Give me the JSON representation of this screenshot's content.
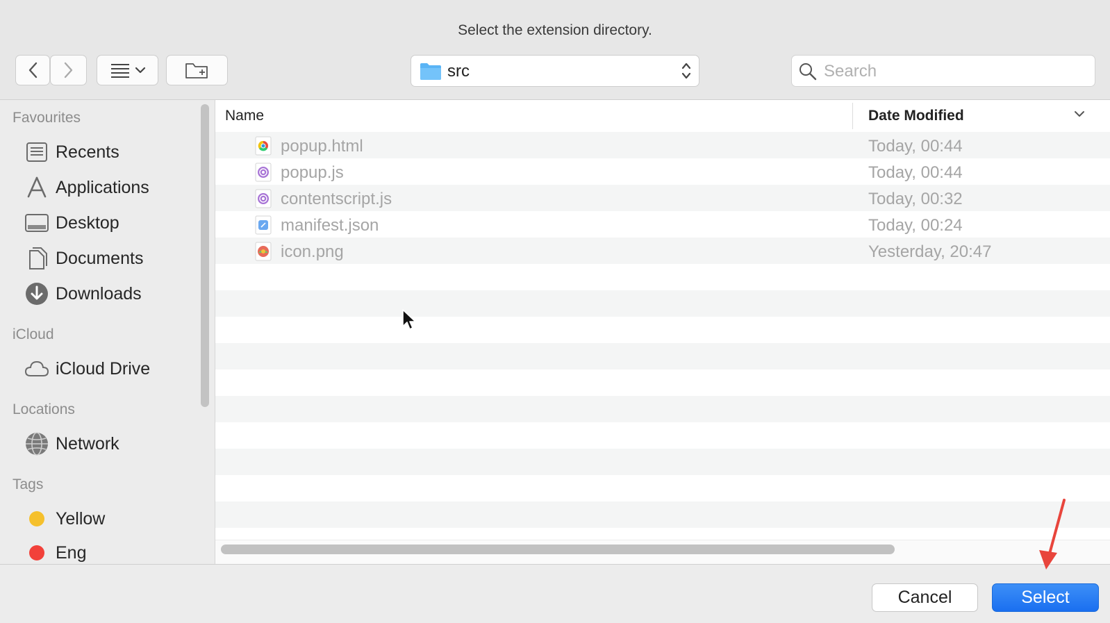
{
  "dialog": {
    "title": "Select the extension directory."
  },
  "toolbar": {
    "path_label": "src",
    "search_placeholder": "Search"
  },
  "sidebar": {
    "sections": [
      {
        "header": "Favourites",
        "items": [
          {
            "label": "Recents",
            "icon": "recents-icon"
          },
          {
            "label": "Applications",
            "icon": "applications-icon"
          },
          {
            "label": "Desktop",
            "icon": "desktop-icon"
          },
          {
            "label": "Documents",
            "icon": "documents-icon"
          },
          {
            "label": "Downloads",
            "icon": "downloads-icon"
          }
        ]
      },
      {
        "header": "iCloud",
        "items": [
          {
            "label": "iCloud Drive",
            "icon": "cloud-icon"
          }
        ]
      },
      {
        "header": "Locations",
        "items": [
          {
            "label": "Network",
            "icon": "network-icon"
          }
        ]
      },
      {
        "header": "Tags",
        "items": [
          {
            "label": "Yellow",
            "icon": "tag-yellow-icon",
            "color": "#f5c02c"
          },
          {
            "label": "Eng",
            "icon": "tag-red-icon",
            "color": "#f2413a"
          }
        ]
      }
    ]
  },
  "file_list": {
    "columns": {
      "name": "Name",
      "date": "Date Modified"
    },
    "files": [
      {
        "name": "popup.html",
        "date": "Today, 00:44",
        "icon": "chrome-html-file-icon"
      },
      {
        "name": "popup.js",
        "date": "Today, 00:44",
        "icon": "js-file-icon"
      },
      {
        "name": "contentscript.js",
        "date": "Today, 00:32",
        "icon": "js-file-icon"
      },
      {
        "name": "manifest.json",
        "date": "Today, 00:24",
        "icon": "json-file-icon"
      },
      {
        "name": "icon.png",
        "date": "Yesterday, 20:47",
        "icon": "image-file-icon"
      }
    ]
  },
  "buttons": {
    "cancel": "Cancel",
    "select": "Select"
  },
  "colors": {
    "accent": "#1a6ff0",
    "folder": "#5ab4f5",
    "arrow": "#e8453c"
  }
}
